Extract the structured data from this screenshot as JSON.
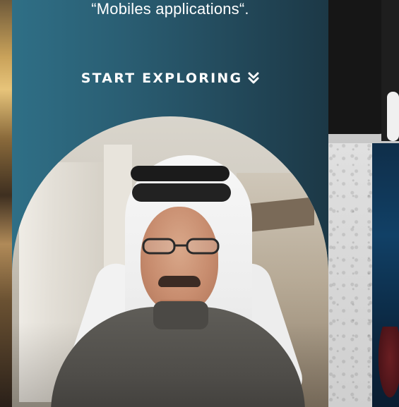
{
  "hero": {
    "subtitle": "“Mobiles applications“.",
    "cta_label": "START EXPLORING",
    "cta_icon": "double-chevron-down-icon"
  },
  "colors": {
    "hero_bg_left": "#2f6f86",
    "hero_bg_right": "#1c3846",
    "text": "#ffffff"
  }
}
